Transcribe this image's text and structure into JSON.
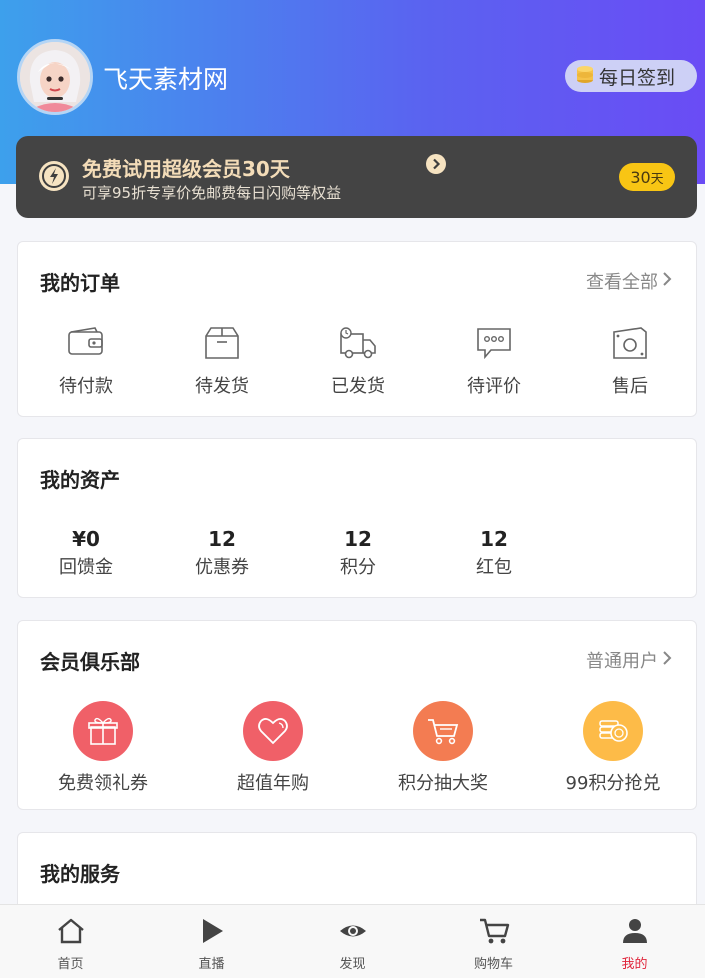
{
  "header": {
    "brand": "飞天素材网",
    "checkin_label": "每日签到"
  },
  "vip_banner": {
    "title": "免费试用超级会员30天",
    "subtitle": "可享95折专享价免邮费每日闪购等权益",
    "days_number": "30",
    "days_unit": "天"
  },
  "orders": {
    "title": "我的订单",
    "view_all": "查看全部",
    "items": [
      {
        "label": "待付款",
        "icon": "wallet-icon"
      },
      {
        "label": "待发货",
        "icon": "box-icon"
      },
      {
        "label": "已发货",
        "icon": "truck-icon"
      },
      {
        "label": "待评价",
        "icon": "comment-icon"
      },
      {
        "label": "售后",
        "icon": "refund-icon"
      }
    ]
  },
  "assets": {
    "title": "我的资产",
    "items": [
      {
        "value": "¥0",
        "label": "回馈金"
      },
      {
        "value": "12",
        "label": "优惠券"
      },
      {
        "value": "12",
        "label": "积分"
      },
      {
        "value": "12",
        "label": "红包"
      }
    ]
  },
  "club": {
    "title": "会员俱乐部",
    "level": "普通用户",
    "items": [
      {
        "label": "免费领礼券",
        "icon": "gift-icon",
        "color": "#f06068"
      },
      {
        "label": "超值年购",
        "icon": "heart-icon",
        "color": "#f06068"
      },
      {
        "label": "积分抽大奖",
        "icon": "cart-icon",
        "color": "#f37c52"
      },
      {
        "label": "99积分抢兑",
        "icon": "coins-icon",
        "color": "#fdbb48"
      }
    ]
  },
  "services": {
    "title": "我的服务"
  },
  "tabbar": {
    "items": [
      {
        "label": "首页",
        "icon": "home-icon"
      },
      {
        "label": "直播",
        "icon": "play-icon"
      },
      {
        "label": "发现",
        "icon": "eye-icon"
      },
      {
        "label": "购物车",
        "icon": "cart-icon"
      },
      {
        "label": "我的",
        "icon": "user-icon"
      }
    ],
    "active_color": "#e0253b"
  }
}
